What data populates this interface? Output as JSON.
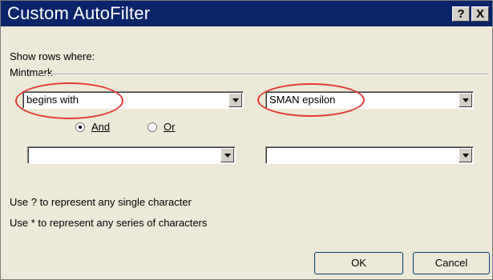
{
  "dialog": {
    "title": "Custom AutoFilter",
    "help_label": "?",
    "close_label": "X",
    "show_rows_label": "Show rows where:",
    "field_label": "Mintmark",
    "row1": {
      "operator": "begins with",
      "value": "SMAN epsilon"
    },
    "logic": {
      "and_label": "And",
      "or_label": "Or",
      "selected": "And"
    },
    "row2": {
      "operator": "",
      "value": ""
    },
    "hint1": "Use ? to represent any single character",
    "hint2": "Use * to represent any series of characters",
    "ok_label": "OK",
    "cancel_label": "Cancel"
  },
  "colors": {
    "titlebar": "#0a246a",
    "dialog_bg": "#ece9d8",
    "annotation": "#e53935"
  }
}
